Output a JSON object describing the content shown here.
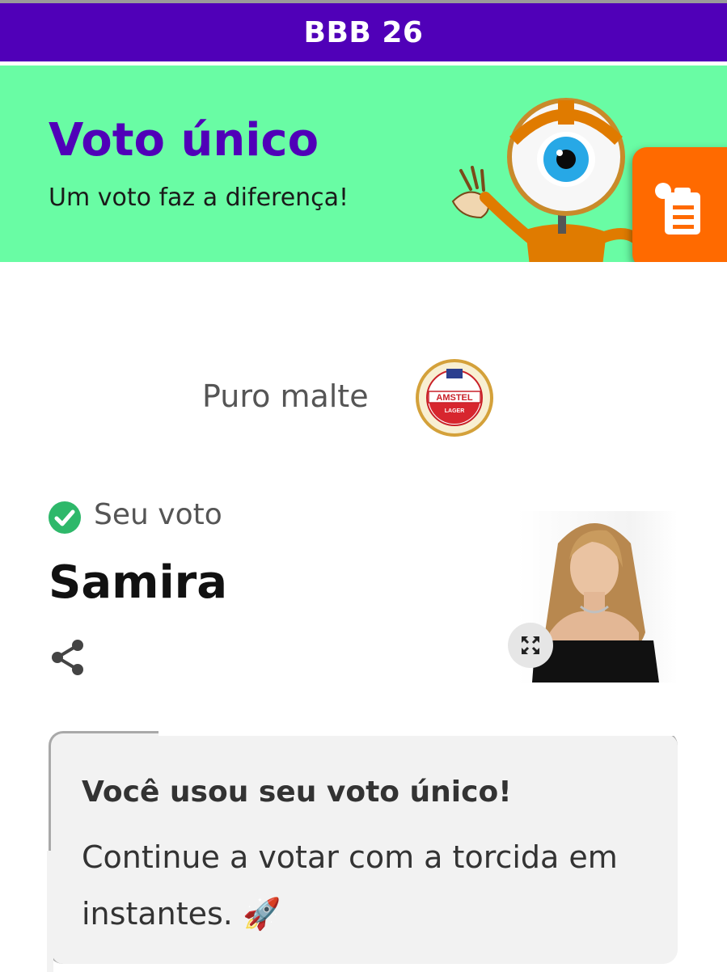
{
  "header": {
    "title": "BBB 26"
  },
  "banner": {
    "title": "Voto único",
    "subtitle": "Um voto faz a diferença!",
    "mascot_icon": "big-brother-eye-mascot",
    "floating_button_icon": "clipboard-list-icon",
    "colors": {
      "background": "#69fca4",
      "title": "#5000b8",
      "button": "#ff6a00"
    }
  },
  "sponsor": {
    "tagline": "Puro malte",
    "logo": {
      "brand": "AMSTEL",
      "sub": "LAGER"
    }
  },
  "vote": {
    "status_icon": "check-circle-icon",
    "label": "Seu voto",
    "name": "Samira",
    "share_icon": "share-icon",
    "expand_icon": "expand-icon"
  },
  "info": {
    "title": "Você usou seu voto único!",
    "body": "Continue a votar com a torcida em instantes. 🚀"
  },
  "colors": {
    "topbar": "#5000b8",
    "check": "#2eb86a"
  }
}
